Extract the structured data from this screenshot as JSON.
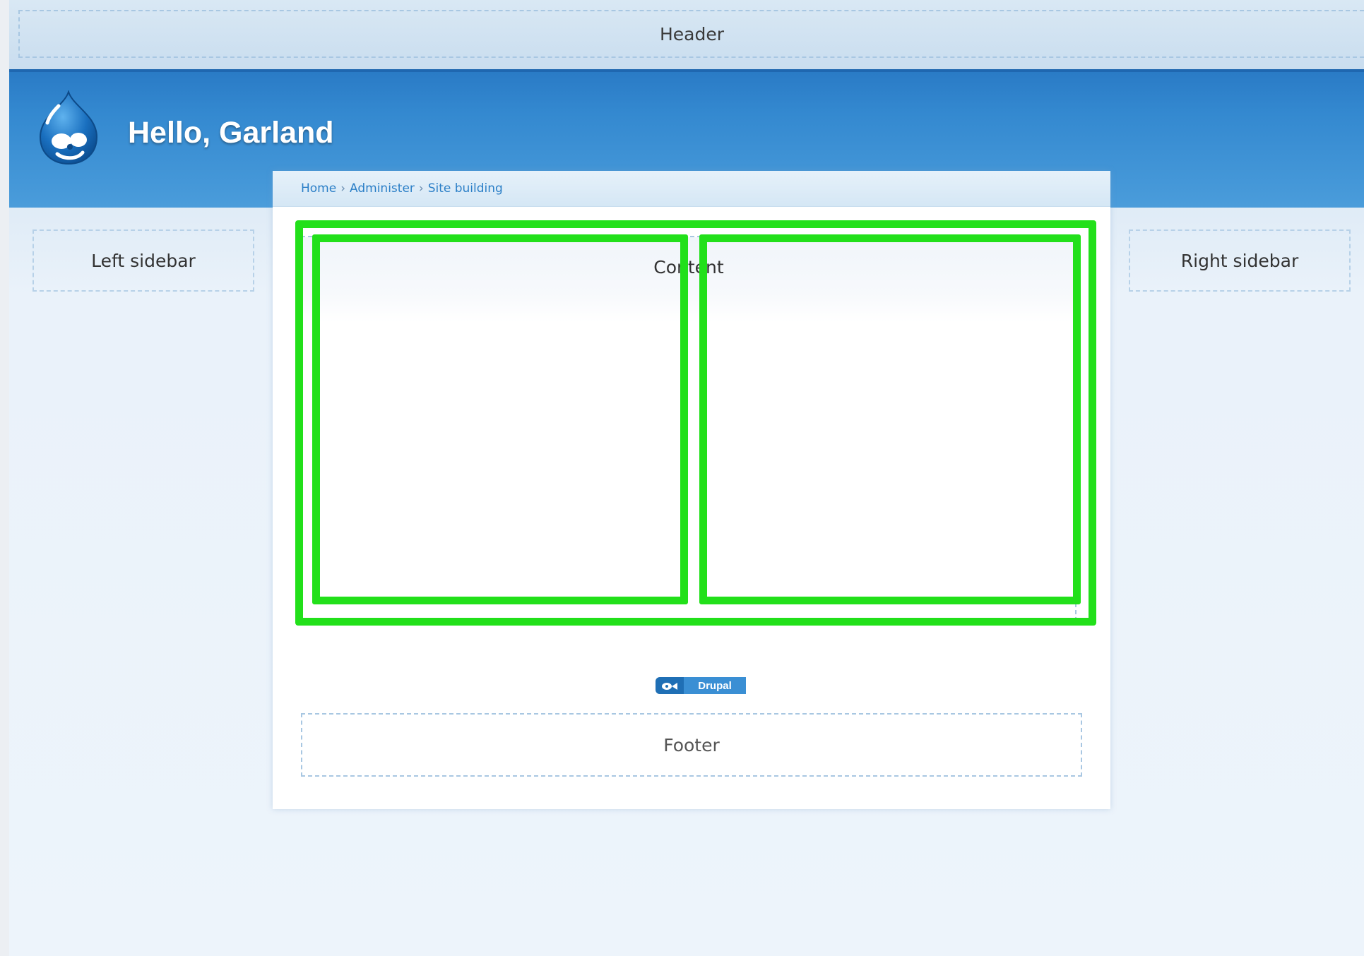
{
  "regions": {
    "header": "Header",
    "left_sidebar": "Left sidebar",
    "right_sidebar": "Right sidebar",
    "content": "Content",
    "footer": "Footer"
  },
  "site": {
    "name": "Hello, Garland",
    "logo_icon": "drupal-drop-icon"
  },
  "breadcrumb": {
    "items": [
      "Home",
      "Administer",
      "Site building"
    ],
    "separator": "›"
  },
  "powered_by": {
    "label": "Drupal",
    "icon": "drupal-drop-icon"
  },
  "colors": {
    "header_blue": "#2a7bc6",
    "highlight_outline": "#22e01a",
    "link_blue": "#2b7fc7"
  }
}
